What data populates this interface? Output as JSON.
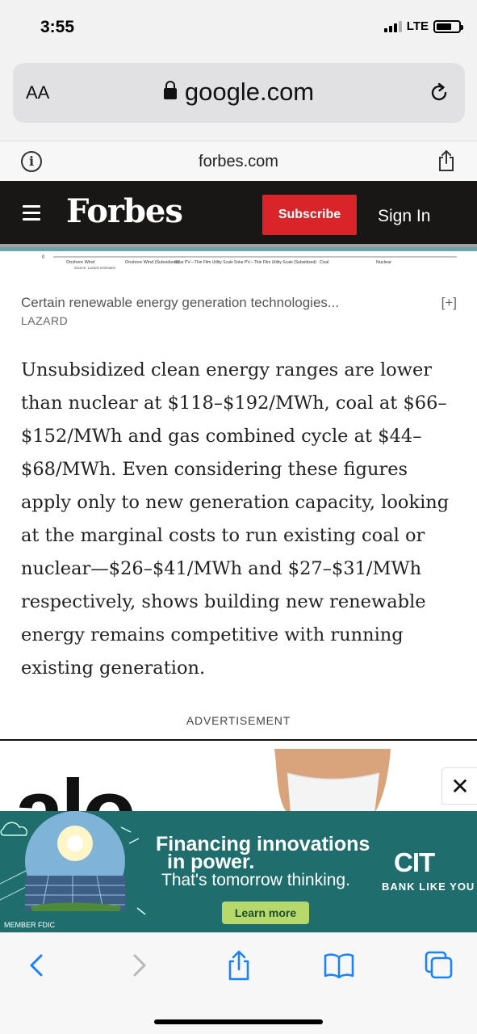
{
  "status_bar": {
    "time": "3:55",
    "network": "LTE"
  },
  "url_bar": {
    "text_size_label": "AA",
    "domain": "google.com"
  },
  "site_bar": {
    "domain": "forbes.com",
    "info_glyph": "i"
  },
  "header": {
    "logo": "Forbes",
    "subscribe_label": "Subscribe",
    "signin_label": "Sign In"
  },
  "chart_strip": {
    "zero_label": "0",
    "labels": [
      "Onshore Wind",
      "Onshore Wind (Subsidized)",
      "Solar PV—Thin Film Utility Scale",
      "Solar PV—Thin Film Utility Scale (Subsidized)",
      "Coal",
      "Nuclear"
    ],
    "source": "Source: Lazard estimates"
  },
  "caption": {
    "text": "Certain renewable energy generation technologies...",
    "expand": "[+]",
    "credit": "LAZARD"
  },
  "article": {
    "paragraph": "Unsubsidized clean energy ranges are lower than nuclear at $118–$192/MWh, coal at $66–$152/MWh and gas combined cycle at $44–$68/MWh. Even considering these figures apply only to new generation capacity, looking at the marginal costs to run existing coal or nuclear—$26–$41/MWh and $27–$31/MWh respectively, shows building new renewable energy remains competitive with running existing generation."
  },
  "advertisement": {
    "label": "ADVERTISEMENT",
    "top_brand_fragment": "alo",
    "close_glyph": "✕",
    "banner": {
      "headline_line1": "Financing innovations",
      "headline_line2": "in power.",
      "subline": "That's tomorrow thinking.",
      "button": "Learn more",
      "brand": "CIT",
      "tagline": "BANK LIKE YOU",
      "fdic": "MEMBER FDIC"
    }
  },
  "toolbar": {
    "icons": [
      "back-icon",
      "forward-icon",
      "share-icon",
      "bookmarks-icon",
      "tabs-icon"
    ]
  },
  "colors": {
    "forbes_bg": "#181716",
    "subscribe_red": "#d9252a",
    "ad_teal": "#1f6e6d",
    "ios_blue": "#1a82fb"
  }
}
